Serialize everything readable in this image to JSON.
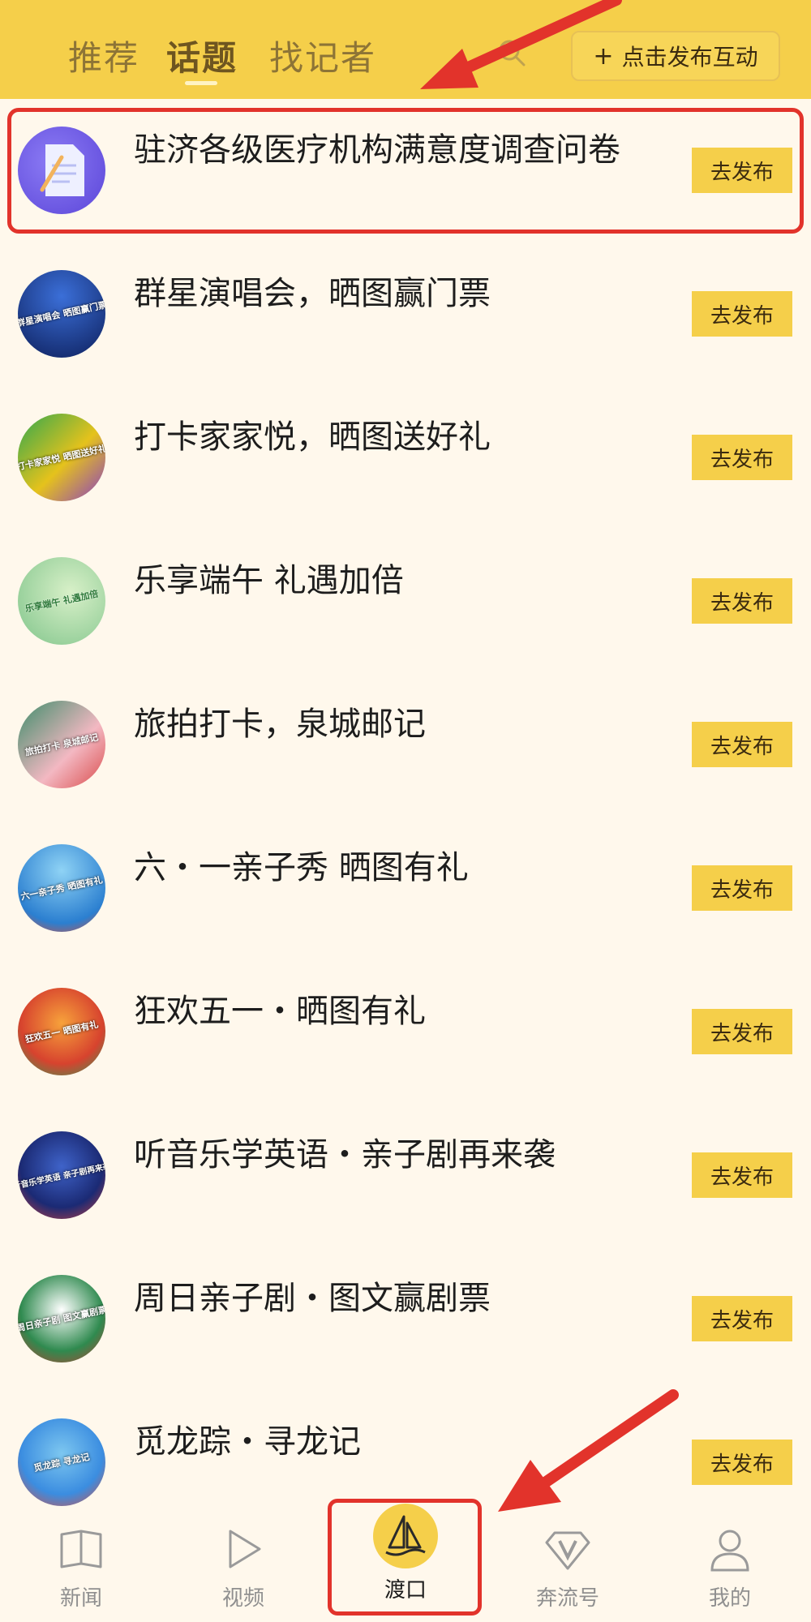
{
  "header": {
    "tabs": [
      {
        "label": "推荐",
        "active": false
      },
      {
        "label": "话题",
        "active": true
      },
      {
        "label": "找记者",
        "active": false
      }
    ],
    "search_icon": "search-icon",
    "publish_button_icon": "+",
    "publish_button_label": "点击发布互动"
  },
  "topics": [
    {
      "title": "驻济各级医疗机构满意度调查问卷",
      "button": "去发布",
      "thumb_text": ""
    },
    {
      "title": "群星演唱会，晒图赢门票",
      "button": "去发布",
      "thumb_text": "群星演唱会 晒图赢门票"
    },
    {
      "title": "打卡家家悦，晒图送好礼",
      "button": "去发布",
      "thumb_text": "打卡家家悦 晒图送好礼"
    },
    {
      "title": "乐享端午  礼遇加倍",
      "button": "去发布",
      "thumb_text": "乐享端午 礼遇加倍"
    },
    {
      "title": "旅拍打卡，泉城邮记",
      "button": "去发布",
      "thumb_text": "旅拍打卡 泉城邮记"
    },
    {
      "title": "六・一亲子秀  晒图有礼",
      "button": "去发布",
      "thumb_text": "六一亲子秀 晒图有礼"
    },
    {
      "title": "狂欢五一・晒图有礼",
      "button": "去发布",
      "thumb_text": "狂欢五一 晒图有礼"
    },
    {
      "title": "听音乐学英语・亲子剧再来袭",
      "button": "去发布",
      "thumb_text": "听音乐学英语 亲子剧再来袭"
    },
    {
      "title": "周日亲子剧・图文赢剧票",
      "button": "去发布",
      "thumb_text": "周日亲子剧 图文赢剧票"
    },
    {
      "title": "觅龙踪・寻龙记",
      "button": "去发布",
      "thumb_text": "觅龙踪 寻龙记"
    }
  ],
  "bottom_nav": [
    {
      "label": "新闻",
      "icon": "book-icon",
      "active": false
    },
    {
      "label": "视频",
      "icon": "play-icon",
      "active": false
    },
    {
      "label": "渡口",
      "icon": "sailboat-icon",
      "active": true
    },
    {
      "label": "奔流号",
      "icon": "diamond-v-icon",
      "active": false
    },
    {
      "label": "我的",
      "icon": "user-icon",
      "active": false
    }
  ],
  "colors": {
    "header_bg": "#f5cf4a",
    "page_bg": "#fff8ec",
    "annotation_red": "#e2332b"
  }
}
